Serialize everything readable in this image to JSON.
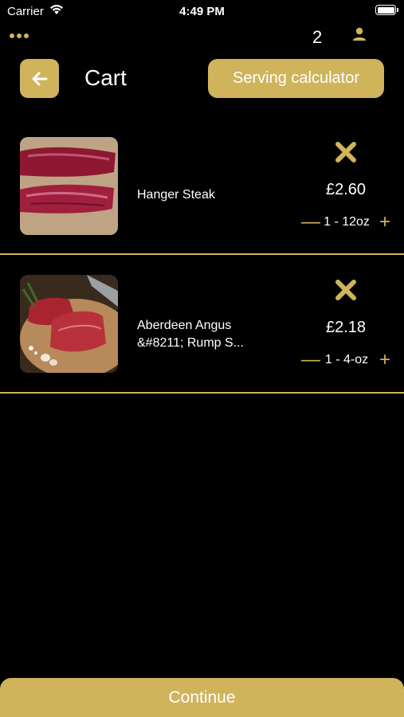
{
  "status_bar": {
    "carrier": "Carrier",
    "time": "4:49 PM"
  },
  "header": {
    "cart_count": "2",
    "title": "Cart",
    "serving_button": "Serving calculator"
  },
  "items": [
    {
      "name": "Hanger Steak",
      "price": "£2.60",
      "quantity": "1 - 12oz",
      "minus": "—",
      "plus": "+"
    },
    {
      "name": "Aberdeen Angus &#8211; Rump S...",
      "price": "£2.18",
      "quantity": "1 - 4-oz",
      "minus": "—",
      "plus": "+"
    }
  ],
  "continue_label": "Continue",
  "colors": {
    "accent": "#cfb45c",
    "background": "#000000"
  }
}
